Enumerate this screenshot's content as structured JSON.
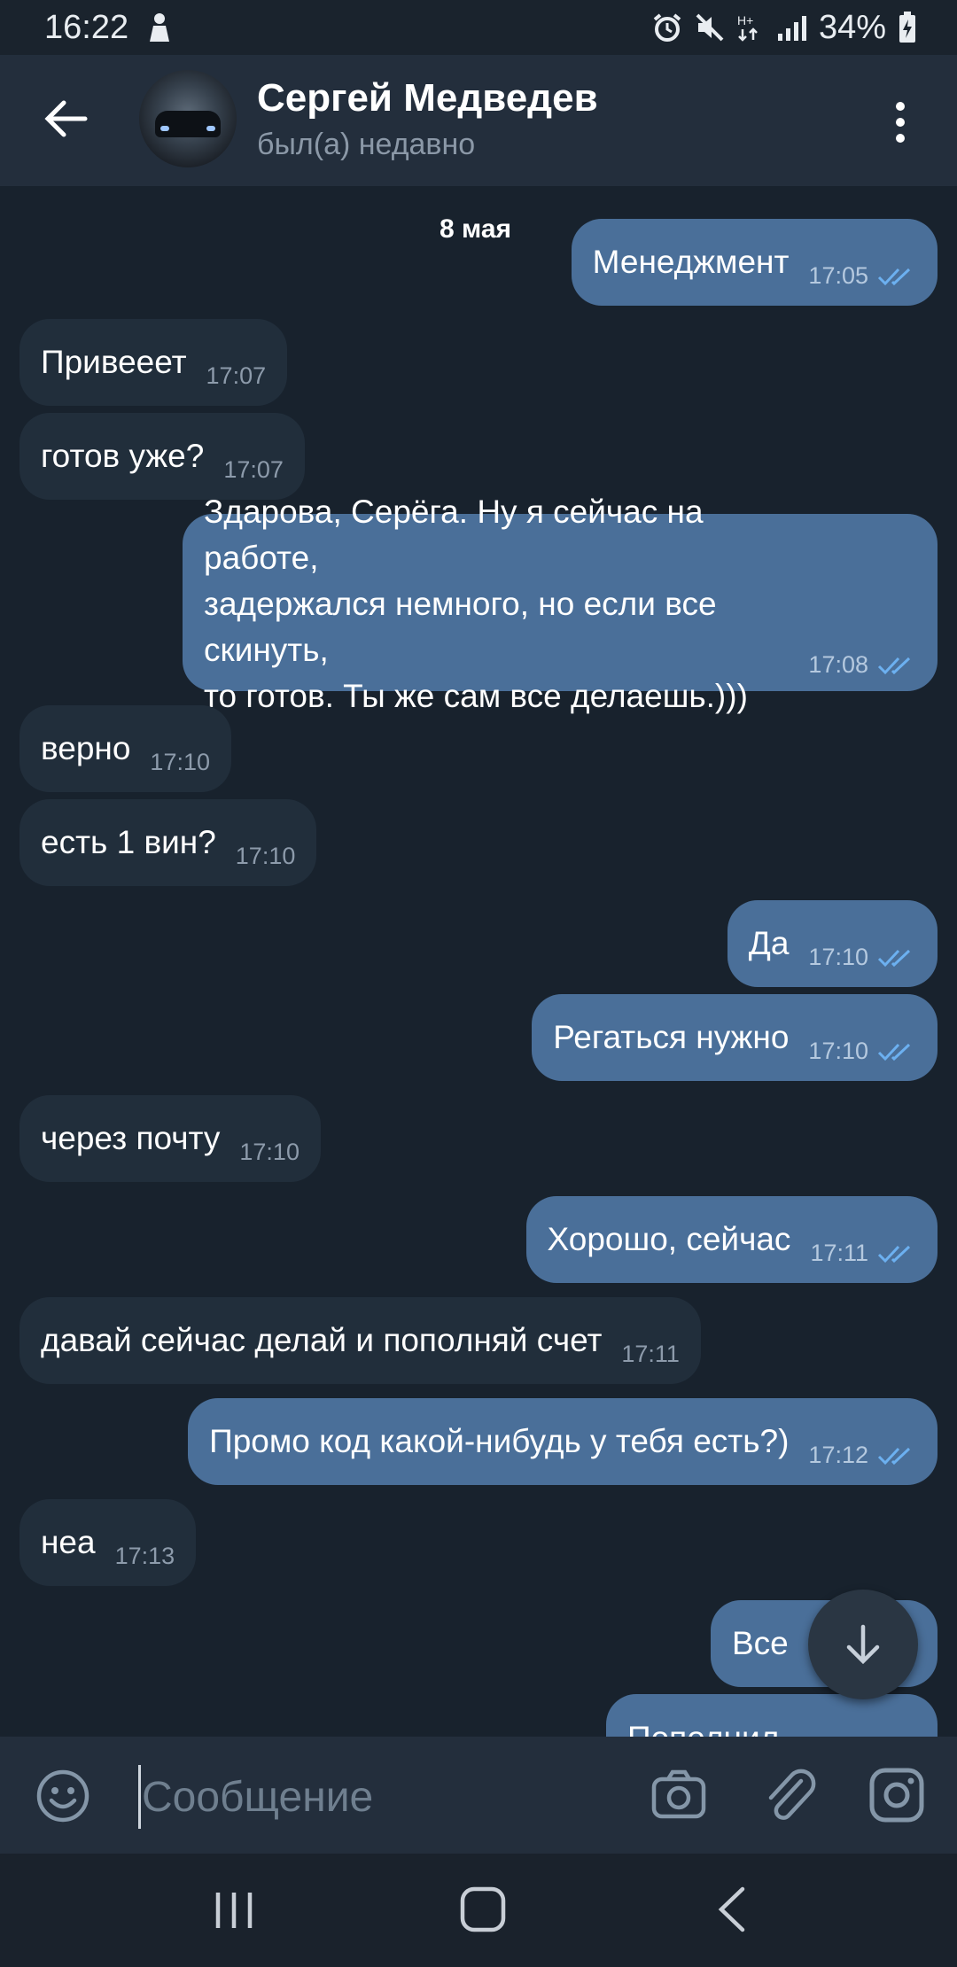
{
  "status_bar": {
    "time": "16:22",
    "battery": "34%",
    "network": "H+",
    "icons": [
      "person-icon",
      "alarm-icon",
      "mute-icon",
      "signal-icon",
      "battery-charging-icon"
    ]
  },
  "header": {
    "contact_name": "Сергей Медведев",
    "last_seen": "был(а) недавно"
  },
  "chat": {
    "date": "8 мая",
    "messages": [
      {
        "dir": "out",
        "text": "Менеджмент",
        "time": "17:05",
        "read": true
      },
      {
        "dir": "in",
        "text": "Привееет",
        "time": "17:07"
      },
      {
        "dir": "in",
        "text": "готов уже?",
        "time": "17:07"
      },
      {
        "dir": "out",
        "text": "Здарова, Серёга. Ну я сейчас на работе,\nзадержался немного,  но если все скинуть,\nто готов. Ты же сам все делаешь.)))",
        "time": "17:08",
        "read": true
      },
      {
        "dir": "in",
        "text": "верно",
        "time": "17:10"
      },
      {
        "dir": "in",
        "text": "есть 1 вин?",
        "time": "17:10"
      },
      {
        "dir": "out",
        "text": "Да",
        "time": "17:10",
        "read": true
      },
      {
        "dir": "out",
        "text": "Регаться нужно",
        "time": "17:10",
        "read": true
      },
      {
        "dir": "in",
        "text": "через почту",
        "time": "17:10"
      },
      {
        "dir": "out",
        "text": "Хорошо,  сейчас",
        "time": "17:11",
        "read": true
      },
      {
        "dir": "in",
        "text": "давай сейчас делай и пополняй счет",
        "time": "17:11"
      },
      {
        "dir": "out",
        "text": "Промо код какой-нибудь у тебя есть?)",
        "time": "17:12",
        "read": true
      },
      {
        "dir": "in",
        "text": "неа",
        "time": "17:13"
      },
      {
        "dir": "out",
        "text": "Все",
        "time": "",
        "read": false
      },
      {
        "dir": "out",
        "text": "Пополнил",
        "time": "",
        "read": false
      }
    ]
  },
  "input": {
    "placeholder": "Сообщение",
    "value": ""
  },
  "colors": {
    "background": "#18222d",
    "header": "#232e3c",
    "incoming_bubble": "#212e3b",
    "outgoing_bubble": "#4a6f99",
    "read_check": "#6cb0f0"
  }
}
